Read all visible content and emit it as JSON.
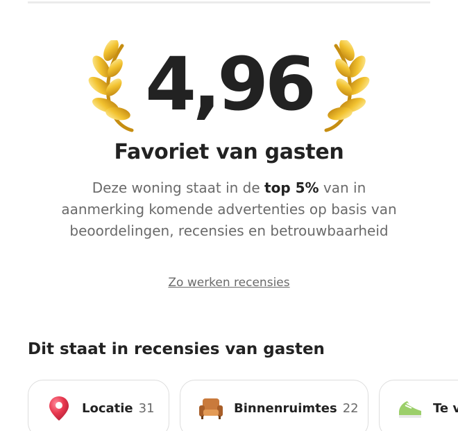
{
  "rating": {
    "value": "4,96"
  },
  "badge": {
    "title": "Favoriet van gasten",
    "description_before": "Deze woning staat in de ",
    "description_bold": "top 5%",
    "description_after": " van in aanmerking komende advertenties op basis van beoordelingen, recensies en betrouwbaarheid",
    "link_label": "Zo werken recensies"
  },
  "reviews_section": {
    "title": "Dit staat in recensies van gasten",
    "chips": [
      {
        "icon": "location-pin-icon",
        "label": "Locatie",
        "count": "31"
      },
      {
        "icon": "armchair-icon",
        "label": "Binnenruimtes",
        "count": "22"
      },
      {
        "icon": "sneaker-icon",
        "label": "Te v",
        "count": ""
      }
    ]
  },
  "colors": {
    "text_primary": "#222222",
    "text_secondary": "#6a6a6a",
    "border": "#dddddd",
    "laurel_gold": "#e0a81c",
    "pin_red": "#e8384f"
  }
}
